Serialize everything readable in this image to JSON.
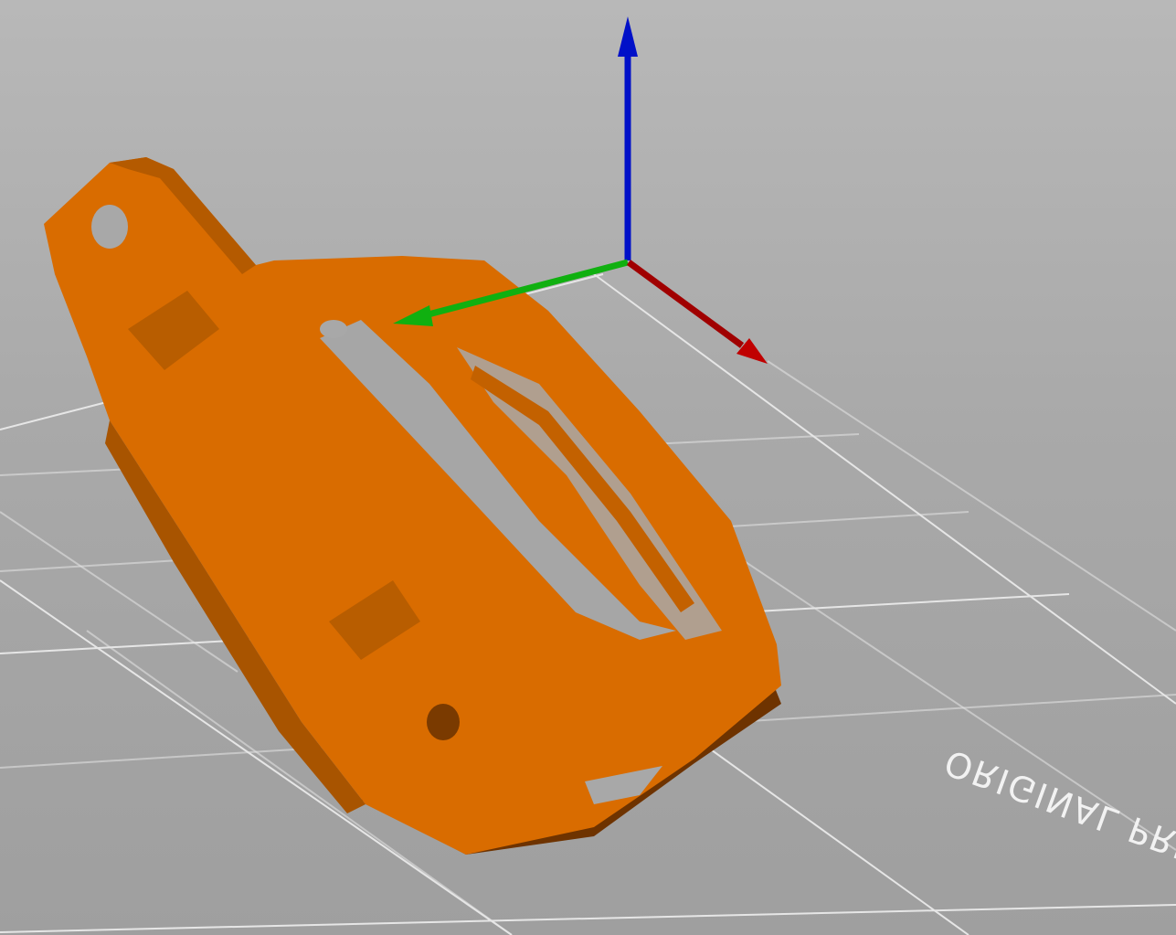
{
  "viewport": {
    "background_top": "#b8b8b8",
    "background_bottom": "#9f9f9f"
  },
  "bed": {
    "label": "ORIGINAL PRU",
    "grid_color": "#e6e6e6",
    "label_color": "#f2f2f2"
  },
  "model": {
    "color": "#d96c00",
    "shadow_color": "#6e3300"
  },
  "axes": {
    "x_color": "#c00000",
    "y_color": "#10b010",
    "z_color": "#0010c8"
  }
}
